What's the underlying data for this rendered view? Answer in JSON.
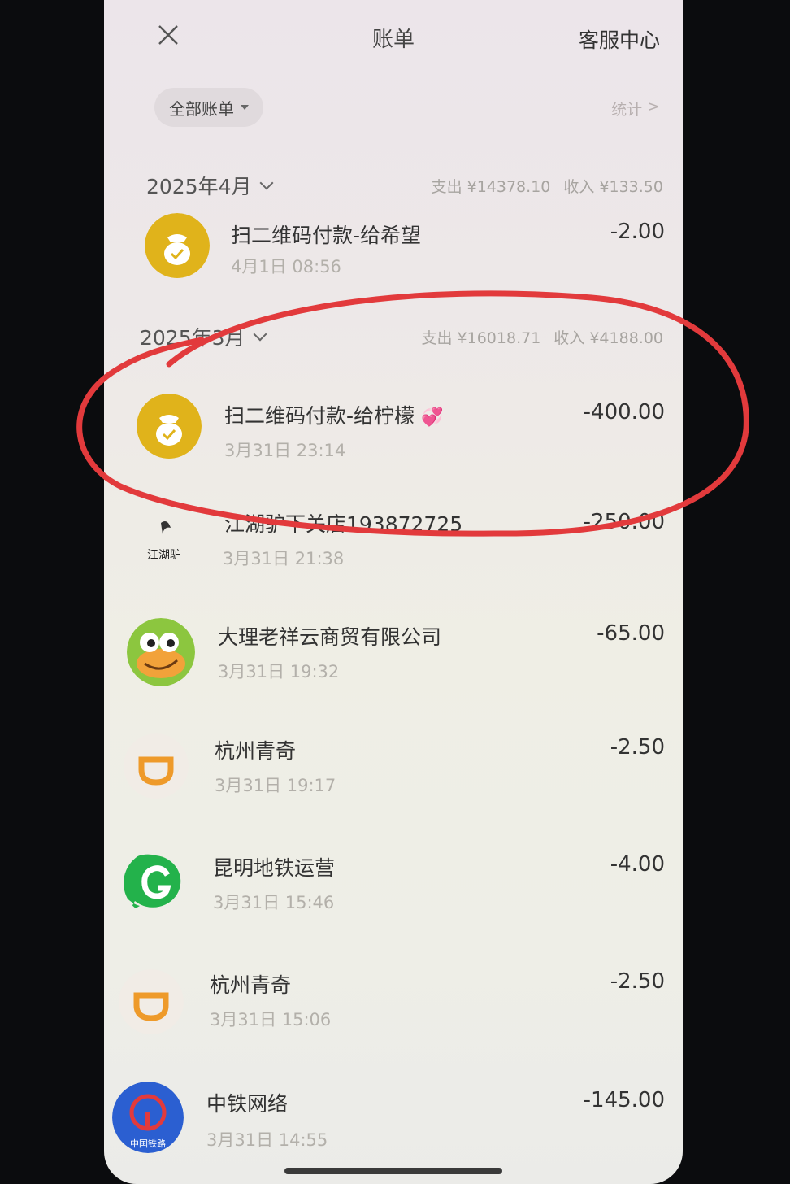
{
  "header": {
    "title": "账单",
    "customer_service": "客服中心"
  },
  "filter": {
    "label": "全部账单"
  },
  "stats": {
    "label": "统计",
    "arrow": ">"
  },
  "months": [
    {
      "label": "2025年4月",
      "expense": "支出 ¥14378.10",
      "income": "收入 ¥133.50"
    },
    {
      "label": "2025年3月",
      "expense": "支出 ¥16018.71",
      "income": "收入 ¥4188.00"
    }
  ],
  "transactions": [
    {
      "name": "扫二维码付款-给希望",
      "time": "4月1日 08:56",
      "amount": "-2.00",
      "icon": "money-bag-icon"
    },
    {
      "name": "扫二维码付款-给柠檬",
      "emoji": "💞",
      "time": "3月31日 23:14",
      "amount": "-400.00",
      "icon": "money-bag-icon"
    },
    {
      "name": "江湖驴下关店193872725",
      "time": "3月31日 21:38",
      "amount": "-250.00",
      "icon": "jianghu-logo",
      "logo_text": "江湖驴"
    },
    {
      "name": "大理老祥云商贸有限公司",
      "time": "3月31日 19:32",
      "amount": "-65.00",
      "icon": "frog-avatar-icon"
    },
    {
      "name": "杭州青奇",
      "time": "3月31日 19:17",
      "amount": "-2.50",
      "icon": "bike-logo-icon"
    },
    {
      "name": "昆明地铁运营",
      "time": "3月31日 15:46",
      "amount": "-4.00",
      "icon": "metro-logo-icon"
    },
    {
      "name": "杭州青奇",
      "time": "3月31日 15:06",
      "amount": "-2.50",
      "icon": "bike-logo-icon"
    },
    {
      "name": "中铁网络",
      "time": "3月31日 14:55",
      "amount": "-145.00",
      "icon": "china-railway-icon",
      "logo_text": "中国铁路"
    }
  ],
  "colors": {
    "annotation": "#e23a3c",
    "money_bag": "#e0b31b",
    "metro_green": "#23b24b",
    "bike_orange": "#ee9a2a",
    "railway_blue": "#2b5fd1"
  }
}
